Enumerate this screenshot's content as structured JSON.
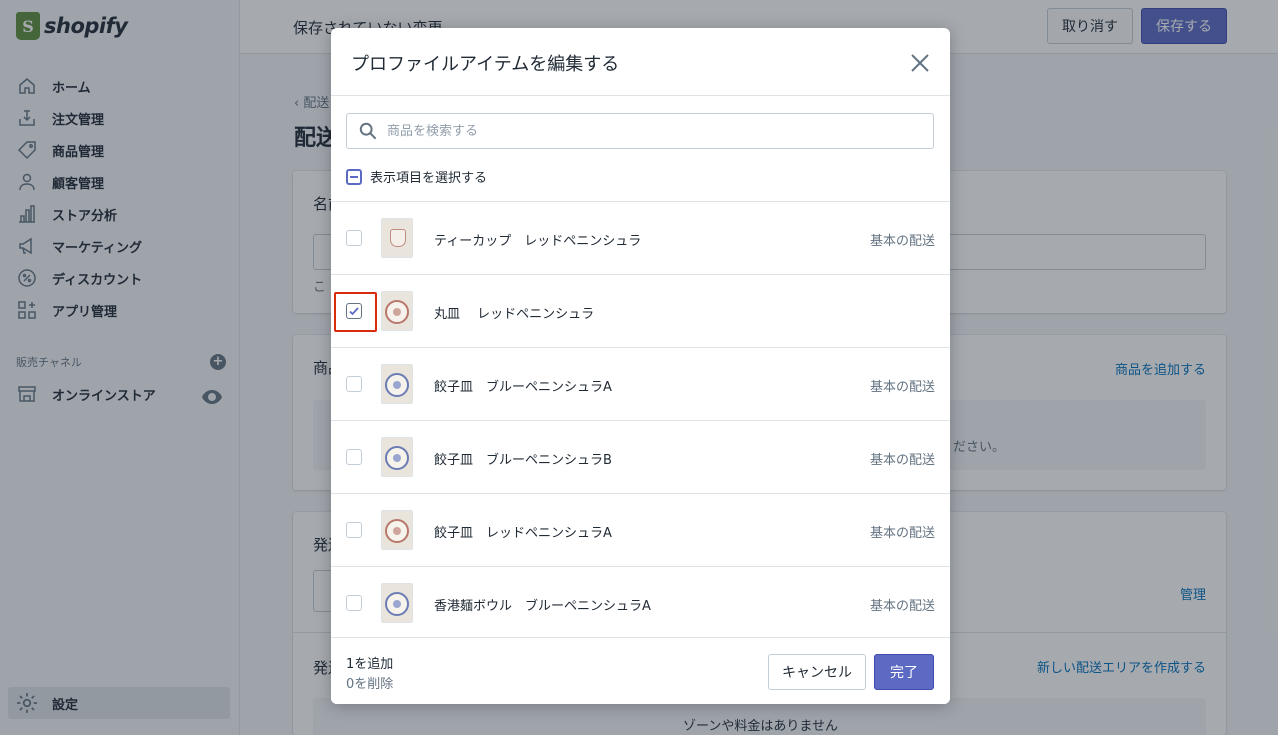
{
  "app": {
    "logo_text": "shopify",
    "logo_mark": "S"
  },
  "topbar": {
    "unsaved_text": "保存されていない変更",
    "discard_label": "取り消す",
    "save_label": "保存する"
  },
  "sidebar": {
    "items": [
      {
        "label": "ホーム",
        "icon": "home-icon"
      },
      {
        "label": "注文管理",
        "icon": "orders-icon"
      },
      {
        "label": "商品管理",
        "icon": "tag-icon"
      },
      {
        "label": "顧客管理",
        "icon": "person-icon"
      },
      {
        "label": "ストア分析",
        "icon": "analytics-icon"
      },
      {
        "label": "マーケティング",
        "icon": "megaphone-icon"
      },
      {
        "label": "ディスカウント",
        "icon": "discount-icon"
      },
      {
        "label": "アプリ管理",
        "icon": "apps-icon"
      }
    ],
    "channels_title": "販売チャネル",
    "online_store": "オンラインストア",
    "settings": "設定"
  },
  "background": {
    "back_link": "配送",
    "page_title": "配送",
    "card1_label": "名前",
    "card1_hint": "こ",
    "card2_label": "商品",
    "card2_link": "商品を追加する",
    "card2_text": "ださい。",
    "card3_label": "発送",
    "card3_manage": "管理",
    "card3_label2": "発送",
    "card3_create": "新しい配送エリアを作成する",
    "card3_empty": "ゾーンや料金はありません"
  },
  "modal": {
    "title": "プロファイルアイテムを編集する",
    "search_placeholder": "商品を検索する",
    "select_all_label": "表示項目を選択する",
    "products": [
      {
        "name": "ティーカップ　レッドペニンシュラ",
        "profile": "基本の配送",
        "checked": false
      },
      {
        "name": "丸皿　 レッドペニンシュラ",
        "profile": "",
        "checked": true
      },
      {
        "name": "餃子皿　ブルーペニンシュラA",
        "profile": "基本の配送",
        "checked": false
      },
      {
        "name": "餃子皿　ブルーペニンシュラB",
        "profile": "基本の配送",
        "checked": false
      },
      {
        "name": "餃子皿　レッドペニンシュラA",
        "profile": "基本の配送",
        "checked": false
      },
      {
        "name": "香港麺ボウル　ブルーペニンシュラA",
        "profile": "基本の配送",
        "checked": false
      }
    ],
    "footer": {
      "added": "1を追加",
      "removed": "0を削除",
      "cancel_label": "キャンセル",
      "done_label": "完了"
    }
  },
  "colors": {
    "primary": "#5c6ac4",
    "link": "#006fbb",
    "highlight": "#d82c0d",
    "brand": "#5e8e3e"
  }
}
